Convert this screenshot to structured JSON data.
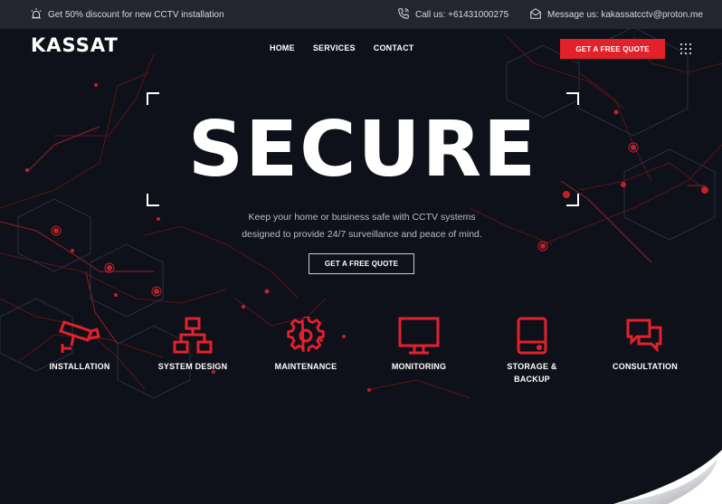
{
  "topbar": {
    "promo": "Get 50% discount for new CCTV installation",
    "call": "Call us: +61431000275",
    "message": "Message us: kakassatcctv@proton.me"
  },
  "brand": {
    "logo": "KASSAT"
  },
  "nav": {
    "home": "HOME",
    "services": "SERVICES",
    "contact": "CONTACT"
  },
  "header_cta": "GET A FREE QUOTE",
  "hero": {
    "title": "SECURE",
    "subtitle_line1": "Keep your home or business safe with CCTV systems",
    "subtitle_line2": "designed to provide 24/7 surveillance and peace of mind.",
    "cta": "GET A FREE QUOTE"
  },
  "services": [
    {
      "label": "INSTALLATION",
      "icon": "cctv-camera-icon"
    },
    {
      "label": "SYSTEM DESIGN",
      "icon": "network-icon"
    },
    {
      "label": "MAINTENANCE",
      "icon": "gear-icon"
    },
    {
      "label": "MONITORING",
      "icon": "monitor-icon"
    },
    {
      "label": "STORAGE &",
      "label2": "BACKUP",
      "icon": "storage-drive-icon"
    },
    {
      "label": "CONSULTATION",
      "icon": "chat-bubbles-icon"
    }
  ],
  "colors": {
    "accent": "#e3212b",
    "background": "#0e111a",
    "topbar": "#23262f"
  }
}
